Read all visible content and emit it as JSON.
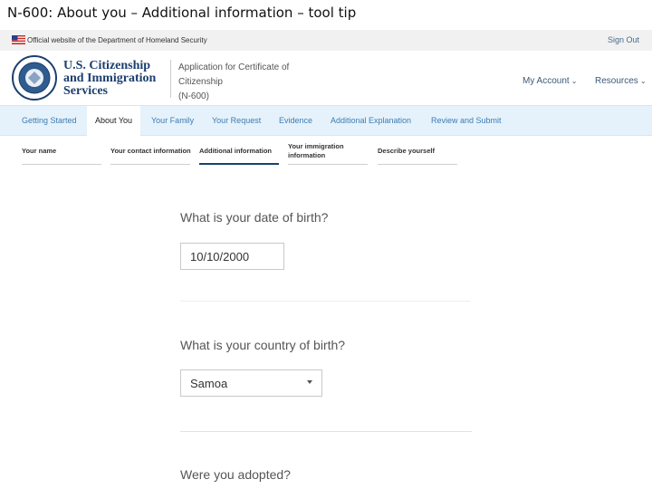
{
  "slide_title": "N-600: About you – Additional information – tool tip",
  "gov_banner": {
    "text": "Official website of the Department of Homeland Security",
    "sign_out": "Sign Out"
  },
  "header": {
    "agency_lines": [
      "U.S. Citizenship",
      "and Immigration",
      "Services"
    ],
    "app_title_lines": [
      "Application for Certificate of",
      "Citizenship",
      "(N-600)"
    ],
    "my_account": "My Account",
    "resources": "Resources"
  },
  "steps": [
    {
      "label": "Getting Started",
      "active": false
    },
    {
      "label": "About You",
      "active": true
    },
    {
      "label": "Your Family",
      "active": false
    },
    {
      "label": "Your Request",
      "active": false
    },
    {
      "label": "Evidence",
      "active": false
    },
    {
      "label": "Additional Explanation",
      "active": false
    },
    {
      "label": "Review and Submit",
      "active": false
    }
  ],
  "subtabs": [
    {
      "label": "Your name"
    },
    {
      "label": "Your contact information"
    },
    {
      "label": "Additional information",
      "active": true
    },
    {
      "label_lines": [
        "Your immigration",
        "information"
      ]
    },
    {
      "label": "Describe yourself"
    }
  ],
  "form": {
    "dob_question": "What is your date of birth?",
    "dob_value": "10/10/2000",
    "country_question": "What is your country of birth?",
    "country_value": "Samoa",
    "adopted_question": "Were you adopted?"
  },
  "colors": {
    "nav_bg": "#e6f2fb",
    "link": "#3d7bb3",
    "agency_blue": "#1c3f6e"
  }
}
